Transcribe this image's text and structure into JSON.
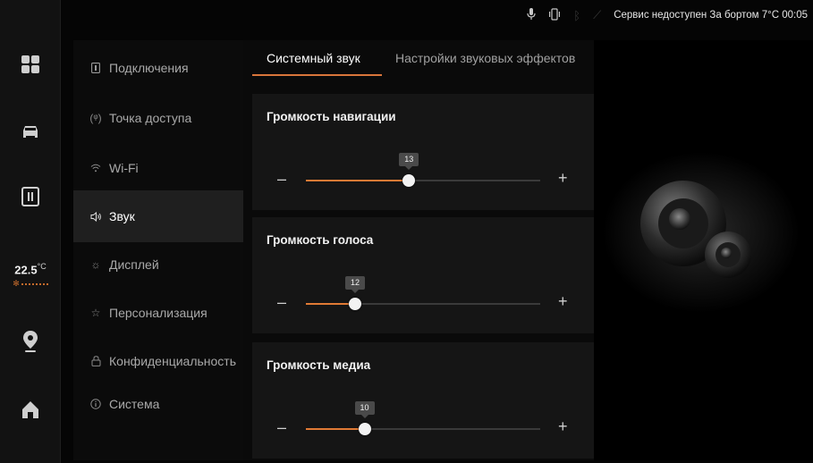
{
  "statusbar": {
    "mic_icon": "microphone-icon",
    "phone_icon": "vibrate-icon",
    "text": "Сервис недоступен За бортом 7°C 00:05"
  },
  "dock": {
    "temperature_value": "22.5",
    "temperature_unit": "°C",
    "items": [
      "apps-grid-icon",
      "car-icon",
      "phone-card-icon",
      "navigation-pin-icon",
      "home-icon"
    ]
  },
  "menu": {
    "items": [
      {
        "label": "Подключения",
        "icon": "connections-icon"
      },
      {
        "label": "Точка доступа",
        "icon": "hotspot-icon"
      },
      {
        "label": "Wi-Fi",
        "icon": "wifi-icon"
      },
      {
        "label": "Звук",
        "icon": "speaker-icon"
      },
      {
        "label": "Дисплей",
        "icon": "brightness-icon"
      },
      {
        "label": "Персонализация",
        "icon": "personalization-icon"
      },
      {
        "label": "Конфиденциальность",
        "icon": "lock-icon"
      },
      {
        "label": "Система",
        "icon": "info-icon"
      }
    ],
    "active_index": 3
  },
  "tabs": [
    {
      "label": "Системный звук"
    },
    {
      "label": "Настройки звуковых эффектов"
    }
  ],
  "sliders": [
    {
      "title": "Громкость навигации",
      "value": "13",
      "level": 0.44
    },
    {
      "title": "Громкость голоса",
      "value": "12",
      "level": 0.21
    },
    {
      "title": "Громкость медиа",
      "value": "10",
      "level": 0.25
    }
  ],
  "controls": {
    "minus": "–",
    "plus": "+"
  },
  "colors": {
    "accent": "#e07a35"
  }
}
